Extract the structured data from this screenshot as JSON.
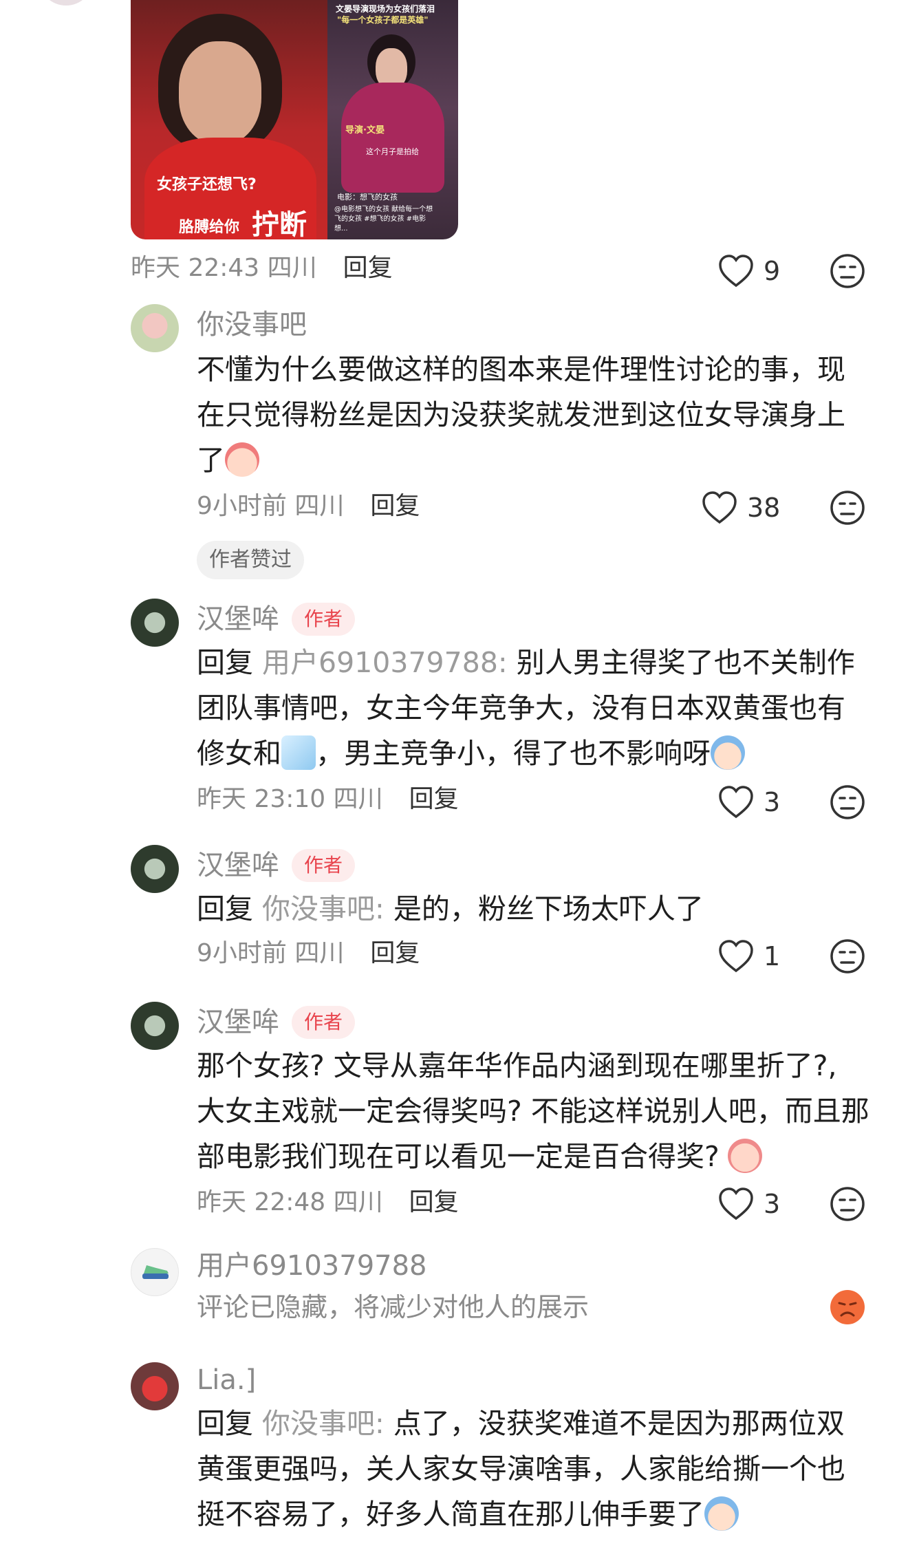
{
  "image_post": {
    "left_caption_1": "女孩子还想飞?",
    "left_caption_2": "胳膊给你",
    "left_caption_big": "拧断",
    "right_title_1": "文晏导演现场为女孩们落泪",
    "right_title_2": "\"每一个女孩子都是英雄\"",
    "right_label": "导演·文晏",
    "right_sub": "这个月子是拍给",
    "right_tag": "电影：想飞的女孩",
    "right_hashtags": "@电影想飞的女孩 献给每一个想飞的女孩 #想飞的女孩 #电影想..."
  },
  "comments": [
    {
      "id": "c0",
      "meta": "昨天 22:43 四川",
      "reply_label": "回复",
      "likes": "9"
    },
    {
      "id": "c1",
      "name": "你没事吧",
      "text": "不懂为什么要做这样的图本来是件理性讨论的事，现在只觉得粉丝是因为没获奖就发泄到这位女导演身上了",
      "meta": "9小时前 四川",
      "reply_label": "回复",
      "likes": "38",
      "badge": "作者赞过"
    },
    {
      "id": "c2",
      "name": "汉堡哞",
      "author_tag": "作者",
      "reply_prefix": "回复",
      "reply_to": "用户6910379788:",
      "text_1": "别人男主得奖了也不关制作团队事情吧，女主今年竞争大，没有日本双黄蛋也有修女和",
      "text_2": "，男主竞争小，得了也不影响呀",
      "meta": "昨天 23:10 四川",
      "reply_label": "回复",
      "likes": "3"
    },
    {
      "id": "c3",
      "name": "汉堡哞",
      "author_tag": "作者",
      "reply_prefix": "回复",
      "reply_to": "你没事吧:",
      "text": "是的，粉丝下场太吓人了",
      "meta": "9小时前 四川",
      "reply_label": "回复",
      "likes": "1"
    },
    {
      "id": "c4",
      "name": "汉堡哞",
      "author_tag": "作者",
      "text": "那个女孩? 文导从嘉年华作品内涵到现在哪里折了?, 大女主戏就一定会得奖吗? 不能这样说别人吧，而且那部电影我们现在可以看见一定是百合得奖?",
      "meta": "昨天 22:48 四川",
      "reply_label": "回复",
      "likes": "3"
    },
    {
      "id": "c5",
      "name": "用户6910379788",
      "hidden_text": "评论已隐藏，将减少对他人的展示"
    },
    {
      "id": "c6",
      "name": "Lia.]",
      "reply_prefix": "回复",
      "reply_to": "你没事吧:",
      "text": "点了，没获奖难道不是因为那两位双黄蛋更强吗，关人家女导演啥事，人家能给撕一个也挺不容易了，好多人简直在那儿伸手要了"
    }
  ],
  "colors": {
    "author_tag": "#e8444d",
    "meta_gray": "#8a8a8a",
    "hidden_face": "#f26b3a"
  }
}
